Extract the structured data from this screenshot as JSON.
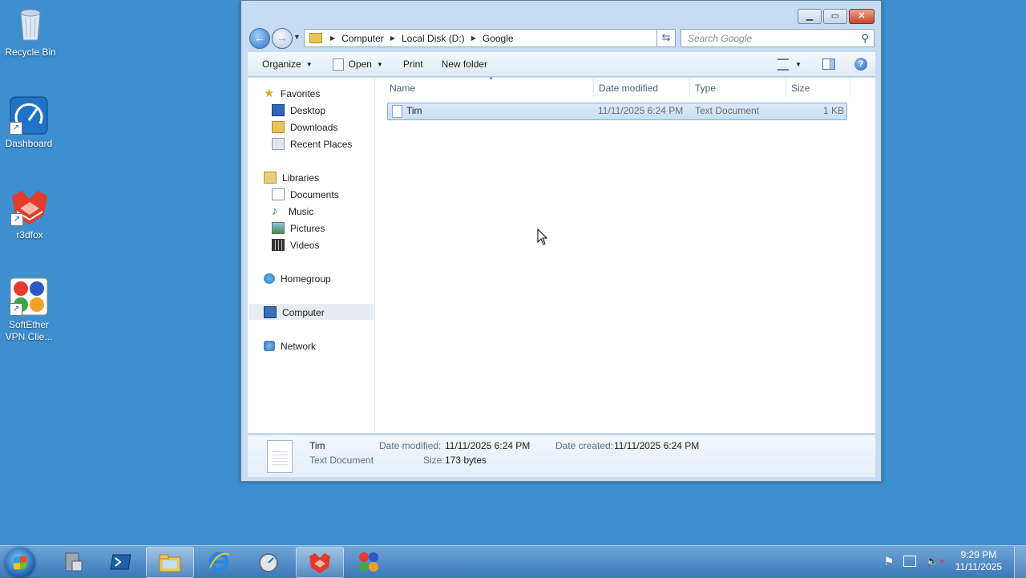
{
  "desktop": {
    "icons": [
      {
        "label": "Recycle Bin"
      },
      {
        "label": "Dashboard"
      },
      {
        "label": "r3dfox"
      },
      {
        "label": "SoftEther VPN Clie..."
      }
    ]
  },
  "window": {
    "breadcrumb": [
      "Computer",
      "Local Disk (D:)",
      "Google"
    ],
    "search_placeholder": "Search Google",
    "toolbar": {
      "organize": "Organize",
      "open": "Open",
      "print": "Print",
      "new_folder": "New folder"
    },
    "nav": {
      "favorites": "Favorites",
      "desktop": "Desktop",
      "downloads": "Downloads",
      "recent": "Recent Places",
      "libraries": "Libraries",
      "documents": "Documents",
      "music": "Music",
      "pictures": "Pictures",
      "videos": "Videos",
      "homegroup": "Homegroup",
      "computer": "Computer",
      "network": "Network"
    },
    "columns": [
      "Name",
      "Date modified",
      "Type",
      "Size"
    ],
    "files": [
      {
        "name": "Tim",
        "modified": "11/11/2025 6:24 PM",
        "type": "Text Document",
        "size": "1 KB"
      }
    ],
    "details": {
      "name": "Tim",
      "type": "Text Document",
      "date_modified_label": "Date modified:",
      "date_modified": "11/11/2025 6:24 PM",
      "size_label": "Size:",
      "size": "173 bytes",
      "date_created_label": "Date created:",
      "date_created": "11/11/2025 6:24 PM"
    }
  },
  "taskbar": {
    "time": "9:29 PM",
    "date": "11/11/2025"
  },
  "colors": {
    "desktop": "#3e8fd0",
    "selection": "#c7dff6",
    "selection_border": "#84acdd"
  }
}
